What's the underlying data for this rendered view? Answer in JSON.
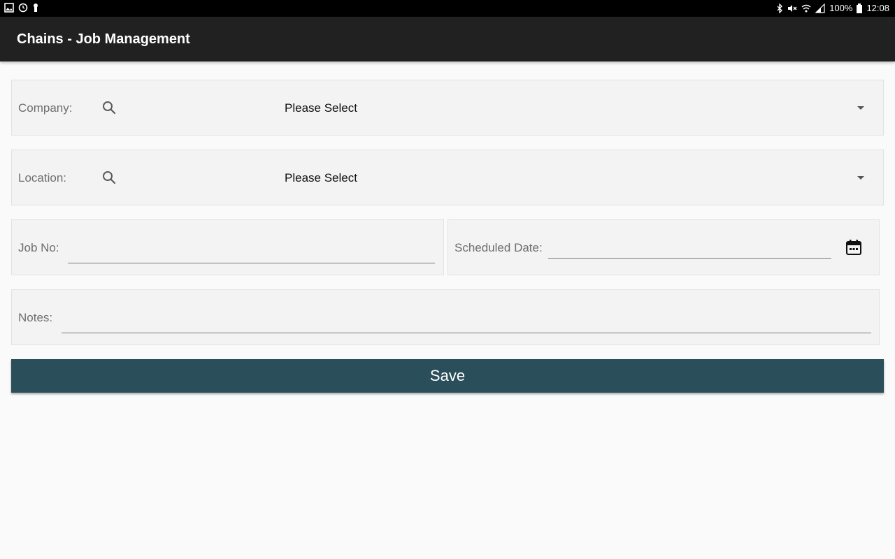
{
  "status_bar": {
    "icons_left": [
      "gallery-icon",
      "sync-icon",
      "keyhole-icon"
    ],
    "icons_right": [
      "bluetooth-icon",
      "mute-icon",
      "wifi-icon",
      "signal-icon",
      "battery-icon"
    ],
    "battery": "100%",
    "time": "12:08"
  },
  "app_bar": {
    "title": "Chains - Job Management",
    "background": "#212121"
  },
  "form": {
    "company": {
      "label": "Company:",
      "value": "Please Select",
      "icon": "search-icon"
    },
    "location": {
      "label": "Location:",
      "value": "Please Select",
      "icon": "search-icon"
    },
    "job_no": {
      "label": "Job No:",
      "value": "",
      "placeholder": ""
    },
    "scheduled_date": {
      "label": "Scheduled Date:",
      "value": "",
      "placeholder": "",
      "icon": "calendar-icon"
    },
    "notes": {
      "label": "Notes:",
      "value": "",
      "placeholder": ""
    },
    "save_label": "Save",
    "save_color": "#2a4e5a"
  }
}
